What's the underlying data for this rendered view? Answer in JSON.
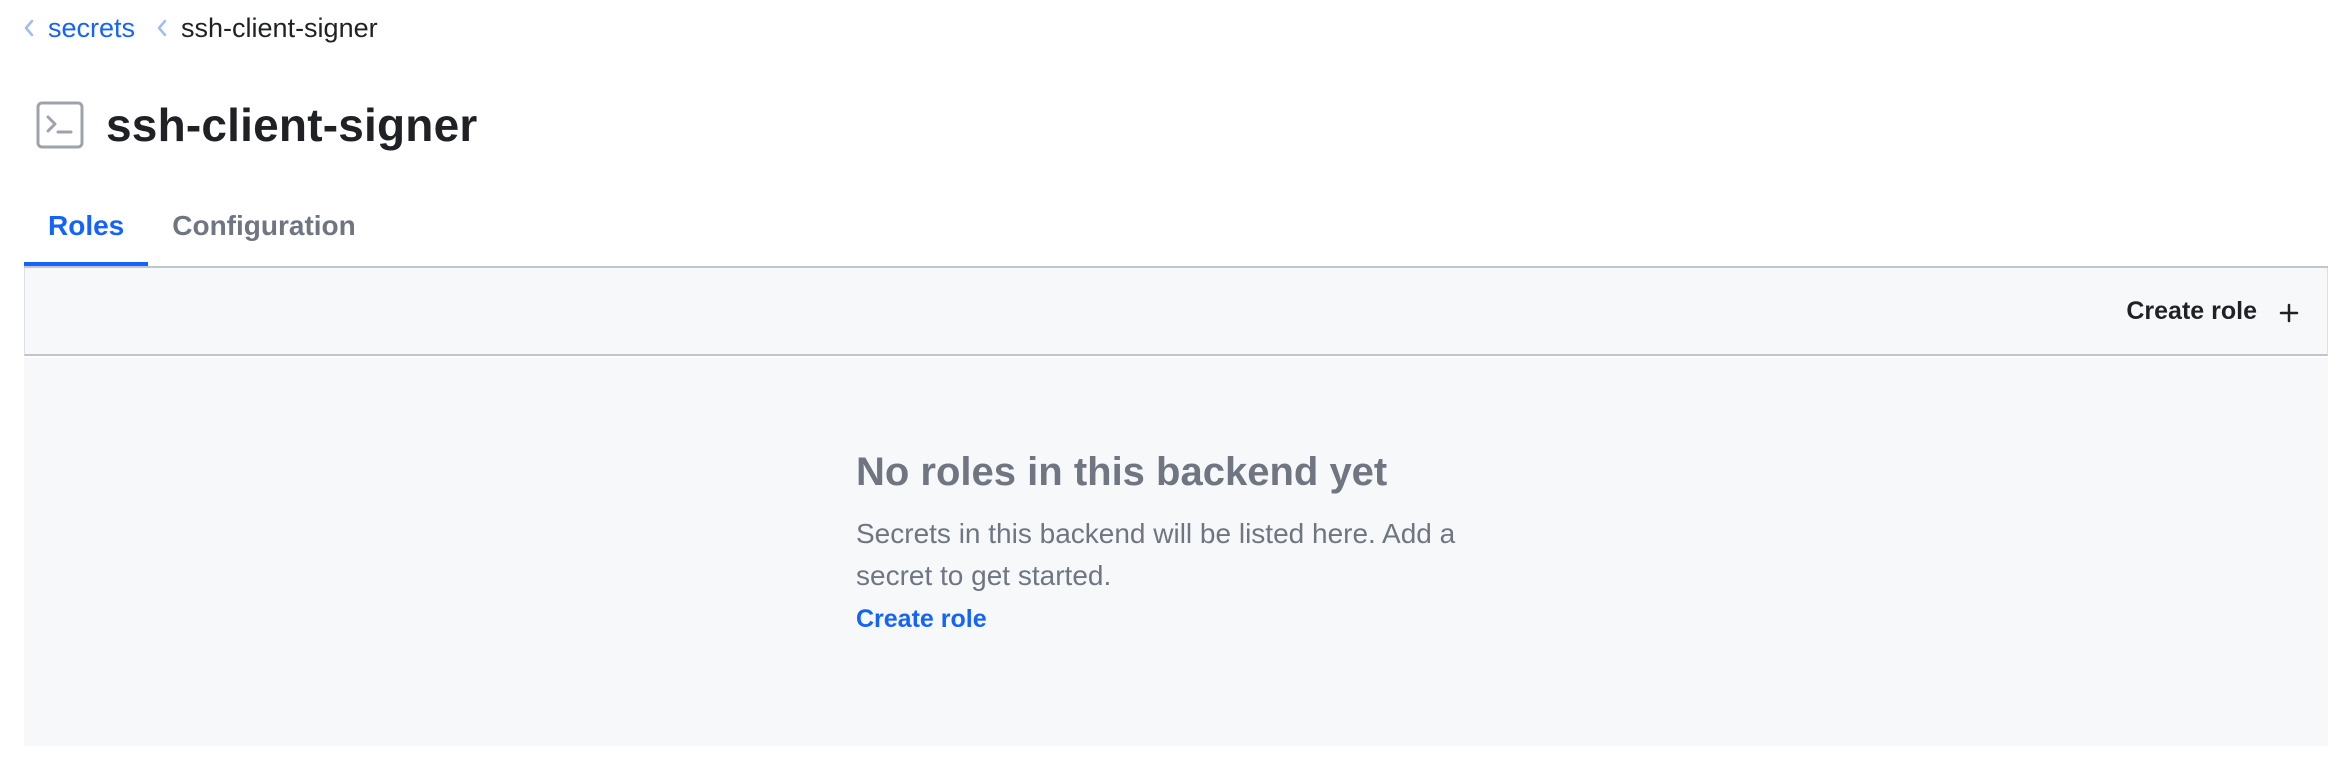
{
  "breadcrumb": {
    "items": [
      {
        "label": "secrets"
      },
      {
        "label": "ssh-client-signer"
      }
    ]
  },
  "header": {
    "title": "ssh-client-signer",
    "icon": "terminal-icon"
  },
  "tabs": [
    {
      "label": "Roles",
      "active": true
    },
    {
      "label": "Configuration",
      "active": false
    }
  ],
  "toolbar": {
    "create_label": "Create role",
    "create_icon": "plus-icon"
  },
  "empty_state": {
    "title": "No roles in this backend yet",
    "message": "Secrets in this backend will be listed here. Add a secret to get started.",
    "link_label": "Create role"
  },
  "colors": {
    "accent": "#1563ff",
    "muted_text": "#6f7682",
    "panel_bg": "#f7f8fa",
    "border": "#c2c5cb"
  }
}
